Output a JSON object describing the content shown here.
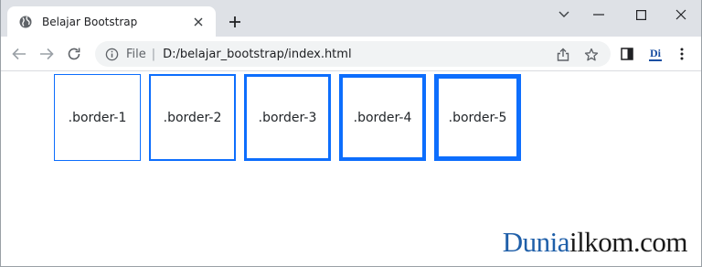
{
  "browser": {
    "tab": {
      "title": "Belajar Bootstrap",
      "favicon": "globe-icon",
      "close": "close-icon"
    },
    "new_tab": "plus-icon",
    "window_controls": [
      "chevron-down-icon",
      "minimize-icon",
      "maximize-icon",
      "close-icon"
    ],
    "toolbar": {
      "nav": [
        "back-arrow-icon",
        "forward-arrow-icon",
        "reload-icon"
      ],
      "address": {
        "scheme": "File",
        "separator": "|",
        "url": "D:/belajar_bootstrap/index.html"
      },
      "omnibox_icons": [
        "share-icon",
        "star-icon"
      ],
      "right_icons": [
        "side-panel-icon",
        "extension-di-icon",
        "kebab-menu-icon"
      ],
      "extension_label": "Di"
    }
  },
  "page": {
    "boxes": [
      {
        "label": ".border-1"
      },
      {
        "label": ".border-2"
      },
      {
        "label": ".border-3"
      },
      {
        "label": ".border-4"
      },
      {
        "label": ".border-5"
      }
    ],
    "accent_color": "#0d6efd"
  },
  "watermark": {
    "part1": "Dunia",
    "part2": "ilkom.com"
  }
}
